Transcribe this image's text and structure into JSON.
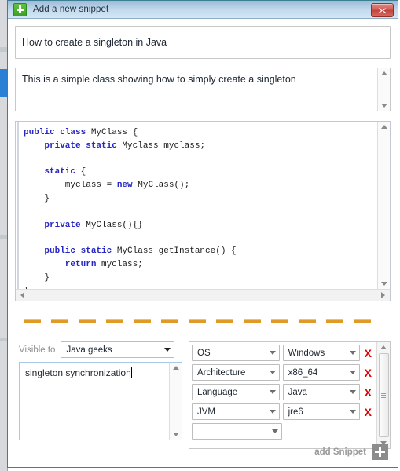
{
  "window": {
    "title": "Add a new snippet",
    "icon": "plus-square-green-icon",
    "close_label": "×",
    "border_color": "#3f7f93",
    "titlebar_color": "#c3dbee"
  },
  "form": {
    "title_value": "How to create a singleton in Java",
    "title_placeholder": "",
    "description_value": "This is a simple class showing how to simply create a singleton",
    "description_placeholder": "",
    "code": {
      "language": "java",
      "keyword_color": "#2727c6",
      "lines": [
        [
          {
            "t": "public class",
            "k": true
          },
          {
            "t": " MyClass {",
            "k": false
          }
        ],
        [
          {
            "t": "    private static",
            "k": true
          },
          {
            "t": " Myclass myclass;",
            "k": false
          }
        ],
        [
          {
            "t": "",
            "k": false
          }
        ],
        [
          {
            "t": "    static",
            "k": true
          },
          {
            "t": " {",
            "k": false
          }
        ],
        [
          {
            "t": "        myclass = ",
            "k": false
          },
          {
            "t": "new",
            "k": true
          },
          {
            "t": " MyClass();",
            "k": false
          }
        ],
        [
          {
            "t": "    }",
            "k": false
          }
        ],
        [
          {
            "t": "",
            "k": false
          }
        ],
        [
          {
            "t": "    private",
            "k": true
          },
          {
            "t": " MyClass(){}",
            "k": false
          }
        ],
        [
          {
            "t": "",
            "k": false
          }
        ],
        [
          {
            "t": "    public static",
            "k": true
          },
          {
            "t": " MyClass getInstance() {",
            "k": false
          }
        ],
        [
          {
            "t": "        return",
            "k": true
          },
          {
            "t": " myclass;",
            "k": false
          }
        ],
        [
          {
            "t": "    }",
            "k": false
          }
        ],
        [
          {
            "t": "}",
            "k": false
          }
        ]
      ]
    },
    "visible_to_label": "Visible to",
    "visible_to_value": "Java geeks",
    "keywords_value": "singleton synchronization",
    "tags": [
      {
        "key": "OS",
        "value": "Windows",
        "delete": "X"
      },
      {
        "key": "Architecture",
        "value": "x86_64",
        "delete": "X"
      },
      {
        "key": "Language",
        "value": "Java",
        "delete": "X"
      },
      {
        "key": "JVM",
        "value": "jre6",
        "delete": "X"
      },
      {
        "key": "",
        "value": null,
        "delete": null
      }
    ]
  },
  "separator": {
    "color": "#e09a28"
  },
  "footer": {
    "add_label": "add Snippet",
    "add_icon": "plus-icon"
  }
}
